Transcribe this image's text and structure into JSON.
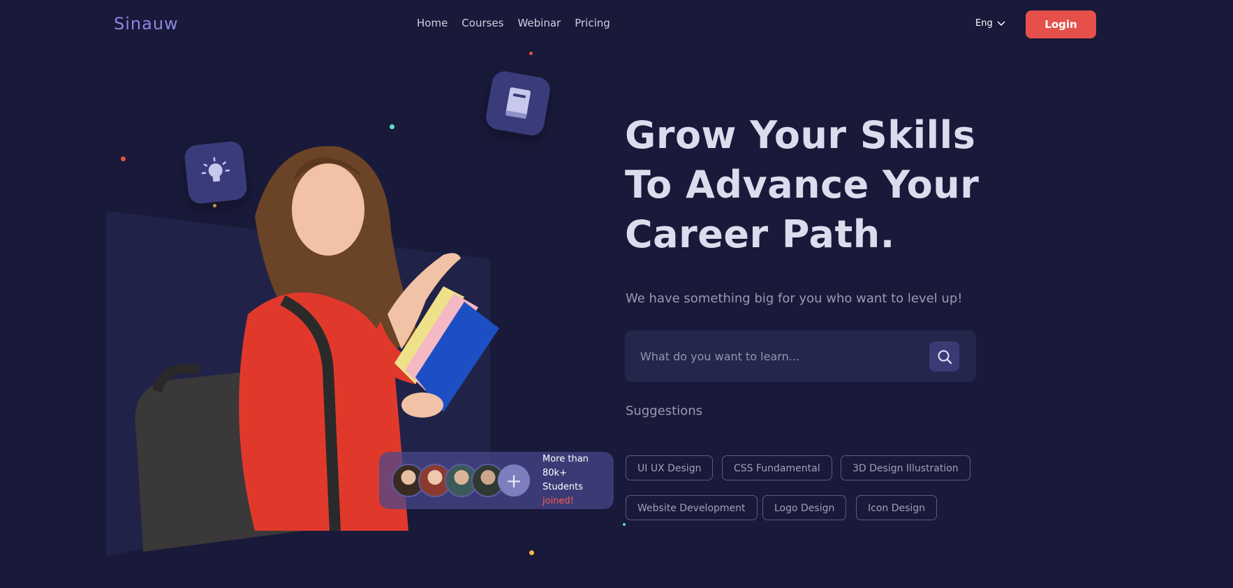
{
  "header": {
    "logo": "Sinauw",
    "nav": [
      "Home",
      "Courses",
      "Webinar",
      "Pricing"
    ],
    "language": "Eng",
    "login_label": "Login"
  },
  "hero": {
    "headline_lines": [
      "Grow Your Skills",
      "To Advance Your",
      "Career Path."
    ],
    "subtitle": "We have something big for you who want to level up!",
    "search": {
      "placeholder": "What do you want to learn..."
    },
    "suggestions_title": "Suggestions",
    "suggestions": [
      "UI UX Design",
      "CSS Fundamental",
      "3D Design Illustration",
      "Website Development",
      "Logo Design",
      "Icon Design"
    ],
    "students_card": {
      "line1": "More than 80k+",
      "line2_prefix": "Students",
      "line2_highlight": "joined!",
      "plus_symbol": "+"
    }
  },
  "colors": {
    "background": "#19193a",
    "accent": "#e5504a",
    "logo": "#8d86e0",
    "highlight": "#ff5a52"
  },
  "icons": {
    "bulb_tile": "lightbulb-icon",
    "book_tile": "book-icon",
    "search": "search-icon",
    "language_caret": "chevron-down-icon"
  }
}
